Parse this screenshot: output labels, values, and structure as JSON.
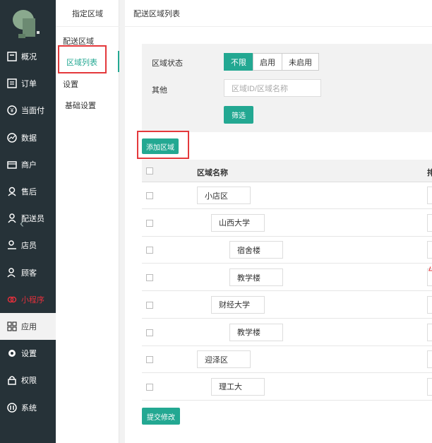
{
  "left_nav": {
    "items": [
      {
        "label": "概况",
        "icon": "dashboard-icon"
      },
      {
        "label": "订单",
        "icon": "order-list-icon"
      },
      {
        "label": "当面付",
        "icon": "yuan-coin-icon"
      },
      {
        "label": "数据",
        "icon": "chart-icon"
      },
      {
        "label": "商户",
        "icon": "store-icon"
      },
      {
        "label": "售后",
        "icon": "service-icon"
      },
      {
        "label": "配送员",
        "icon": "courier-icon"
      },
      {
        "label": "店员",
        "icon": "staff-icon"
      },
      {
        "label": "顾客",
        "icon": "customer-icon"
      },
      {
        "label": "小程序",
        "icon": "mini-program-icon"
      },
      {
        "label": "应用",
        "icon": "apps-icon"
      },
      {
        "label": "设置",
        "icon": "gear-icon"
      },
      {
        "label": "权限",
        "icon": "lock-icon"
      },
      {
        "label": "系统",
        "icon": "system-icon"
      }
    ],
    "active_index": 10,
    "highlight_color": "#e0303c"
  },
  "sub_nav": {
    "header": "指定区域",
    "items": [
      "配送区域",
      "区域列表",
      "设置",
      "基础设置"
    ],
    "selected": "区域列表"
  },
  "main": {
    "title": "配送区域列表",
    "filter": {
      "status_label": "区域状态",
      "status_options": [
        "不限",
        "启用",
        "未启用"
      ],
      "status_selected": "不限",
      "other_label": "其他",
      "search_placeholder": "区域ID/区域名称",
      "filter_button": "筛选"
    },
    "add_button": "添加区域",
    "table": {
      "headers": [
        "区域名称",
        "排"
      ],
      "rows": [
        {
          "name": "小店区",
          "level": 0
        },
        {
          "name": "山西大学",
          "level": 1
        },
        {
          "name": "宿舍楼",
          "level": 2
        },
        {
          "name": "教学楼",
          "level": 2
        },
        {
          "name": "财经大学",
          "level": 1
        },
        {
          "name": "教学楼",
          "level": 2
        },
        {
          "name": "迎泽区",
          "level": 0
        },
        {
          "name": "理工大",
          "level": 1
        }
      ]
    },
    "submit_button": "提交修改"
  },
  "colors": {
    "accent": "#23a892",
    "sidebar_bg": "#263238",
    "annotation_red": "#e4393c"
  }
}
